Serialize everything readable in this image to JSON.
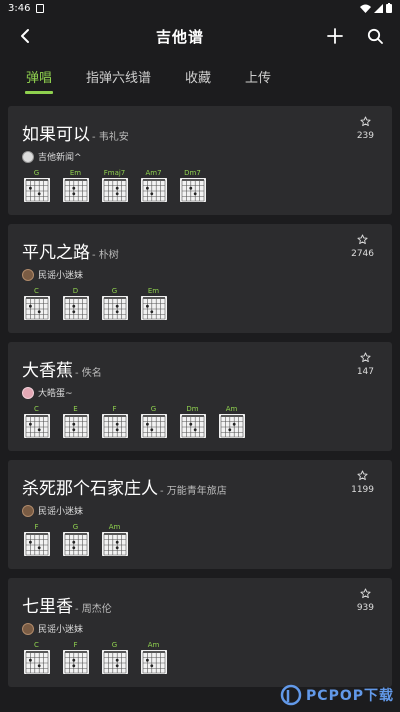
{
  "statusbar": {
    "time": "3:46"
  },
  "appbar": {
    "title": "吉他谱"
  },
  "tabs": [
    {
      "label": "弹唱",
      "active": true
    },
    {
      "label": "指弹六线谱",
      "active": false
    },
    {
      "label": "收藏",
      "active": false
    },
    {
      "label": "上传",
      "active": false
    }
  ],
  "songs": [
    {
      "title": "如果可以",
      "artist": "- 韦礼安",
      "uploader": "吉他新闻^",
      "uploader_avatar": "avatar-white",
      "stars": "239",
      "chords": [
        "G",
        "Em",
        "Fmaj7",
        "Am7",
        "Dm7"
      ]
    },
    {
      "title": "平凡之路",
      "artist": "- 朴树",
      "uploader": "民谣小迷妹",
      "uploader_avatar": "avatar-brown",
      "stars": "2746",
      "chords": [
        "C",
        "D",
        "G",
        "Em"
      ]
    },
    {
      "title": "大香蕉",
      "artist": "- 佚名",
      "uploader": "大皓蛋~",
      "uploader_avatar": "avatar-pink",
      "stars": "147",
      "chords": [
        "C",
        "E",
        "F",
        "G",
        "Dm",
        "Am"
      ]
    },
    {
      "title": "杀死那个石家庄人",
      "artist": "- 万能青年旅店",
      "uploader": "民谣小迷妹",
      "uploader_avatar": "avatar-brown",
      "stars": "1199",
      "chords": [
        "F",
        "G",
        "Am"
      ]
    },
    {
      "title": "七里香",
      "artist": "- 周杰伦",
      "uploader": "民谣小迷妹",
      "uploader_avatar": "avatar-brown",
      "stars": "939",
      "chords": [
        "C",
        "F",
        "G",
        "Am"
      ]
    }
  ],
  "watermark": {
    "text": "PCPOP下载"
  }
}
